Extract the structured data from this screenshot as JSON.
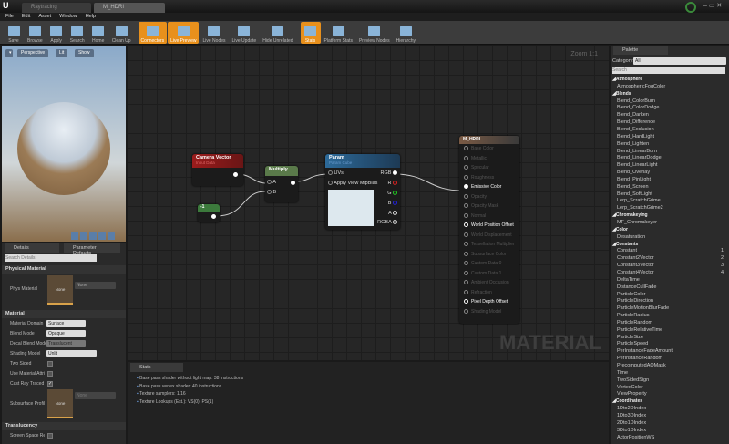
{
  "window": {
    "tabs": [
      "Raytracing",
      "M_HDRI"
    ]
  },
  "menu": [
    "File",
    "Edit",
    "Asset",
    "Window",
    "Help"
  ],
  "toolbar": [
    {
      "label": "Save",
      "active": false
    },
    {
      "label": "Browse",
      "active": false
    },
    {
      "label": "Apply",
      "active": false
    },
    {
      "label": "Search",
      "active": false
    },
    {
      "label": "Home",
      "active": false
    },
    {
      "label": "Clean Up",
      "active": false
    },
    {
      "label": "Connectors",
      "active": true
    },
    {
      "label": "Live Preview",
      "active": true
    },
    {
      "label": "Live Nodes",
      "active": false
    },
    {
      "label": "Live Update",
      "active": false
    },
    {
      "label": "Hide Unrelated",
      "active": false
    },
    {
      "label": "Stats",
      "active": true
    },
    {
      "label": "Platform Stats",
      "active": false
    },
    {
      "label": "Preview Nodes",
      "active": false
    },
    {
      "label": "Hierarchy",
      "active": false
    }
  ],
  "viewport": {
    "perspective": "Perspective",
    "lit": "Lit",
    "show": "Show"
  },
  "details": {
    "tabs": [
      "Details",
      "Parameter Defaults"
    ],
    "search_placeholder": "Search Details",
    "physical_material": {
      "title": "Physical Material",
      "phys_label": "Phys Material",
      "thumb": "None",
      "value": "None"
    },
    "material": {
      "title": "Material",
      "domain_label": "Material Domain",
      "domain": "Surface",
      "blend_label": "Blend Mode",
      "blend": "Opaque",
      "decal_label": "Decal Blend Mode",
      "decal": "Translucent",
      "shading_label": "Shading Model",
      "shading": "Unlit",
      "two_sided": "Two Sided",
      "use_attr": "Use Material Attributes",
      "cast_ray": "Cast Ray Traced Shadows",
      "subsurface_label": "Subsurface Profile",
      "subsurface_thumb": "None",
      "subsurface_value": "None"
    },
    "translucency": {
      "title": "Translucency",
      "ssr": "Screen Space Reflections"
    }
  },
  "graph": {
    "zoom": "Zoom 1:1",
    "watermark": "MATERIAL",
    "camera_vector": {
      "title": "Camera Vector",
      "subtitle": "Input Data"
    },
    "multiply": {
      "title": "Multiply",
      "a": "A",
      "b": "B"
    },
    "constant": {
      "value": "-1"
    },
    "param": {
      "title": "Param",
      "subtitle": "Param Cube",
      "uvs": "UVs",
      "mip": "Apply View MipBias",
      "outputs": [
        "RGB",
        "R",
        "G",
        "B",
        "A",
        "RGBA"
      ]
    },
    "result": {
      "title": "M_HDRI",
      "inputs": [
        {
          "label": "Base Color",
          "active": false
        },
        {
          "label": "Metallic",
          "active": false
        },
        {
          "label": "Specular",
          "active": false
        },
        {
          "label": "Roughness",
          "active": false
        },
        {
          "label": "Emissive Color",
          "active": true
        },
        {
          "label": "Opacity",
          "active": false
        },
        {
          "label": "Opacity Mask",
          "active": false
        },
        {
          "label": "Normal",
          "active": false
        },
        {
          "label": "World Position Offset",
          "active": true
        },
        {
          "label": "World Displacement",
          "active": false
        },
        {
          "label": "Tessellation Multiplier",
          "active": false
        },
        {
          "label": "Subsurface Color",
          "active": false
        },
        {
          "label": "Custom Data 0",
          "active": false
        },
        {
          "label": "Custom Data 1",
          "active": false
        },
        {
          "label": "Ambient Occlusion",
          "active": false
        },
        {
          "label": "Refraction",
          "active": false
        },
        {
          "label": "Pixel Depth Offset",
          "active": true
        },
        {
          "label": "Shading Model",
          "active": false
        }
      ]
    }
  },
  "stats": {
    "tab": "Stats",
    "lines": [
      "Base pass shader without light map: 38 instructions",
      "Base pass vertex shader: 40 instructions",
      "Texture samplers: 1/16",
      "Texture Lookups (Est.): VS(0), PS(1)"
    ]
  },
  "palette": {
    "tab": "Palette",
    "category_label": "Category:",
    "category": "All",
    "search_placeholder": "Search",
    "items": [
      {
        "t": "c",
        "l": "Atmosphere"
      },
      {
        "l": "AtmosphericFogColor"
      },
      {
        "t": "c",
        "l": "Blends"
      },
      {
        "l": "Blend_ColorBurn"
      },
      {
        "l": "Blend_ColorDodge"
      },
      {
        "l": "Blend_Darken"
      },
      {
        "l": "Blend_Difference"
      },
      {
        "l": "Blend_Exclusion"
      },
      {
        "l": "Blend_HardLight"
      },
      {
        "l": "Blend_Lighten"
      },
      {
        "l": "Blend_LinearBurn"
      },
      {
        "l": "Blend_LinearDodge"
      },
      {
        "l": "Blend_LinearLight"
      },
      {
        "l": "Blend_Overlay"
      },
      {
        "l": "Blend_PinLight"
      },
      {
        "l": "Blend_Screen"
      },
      {
        "l": "Blend_SoftLight"
      },
      {
        "l": "Lerp_ScratchGrime"
      },
      {
        "l": "Lerp_ScratchGrime2"
      },
      {
        "t": "c",
        "l": "Chromakeying"
      },
      {
        "l": "MF_Chromakeyer"
      },
      {
        "t": "c",
        "l": "Color"
      },
      {
        "l": "Desaturation"
      },
      {
        "t": "c",
        "l": "Constants"
      },
      {
        "l": "Constant",
        "n": "1"
      },
      {
        "l": "Constant2Vector",
        "n": "2"
      },
      {
        "l": "Constant3Vector",
        "n": "3"
      },
      {
        "l": "Constant4Vector",
        "n": "4"
      },
      {
        "l": "DeltaTime"
      },
      {
        "l": "DistanceCullFade"
      },
      {
        "l": "ParticleColor"
      },
      {
        "l": "ParticleDirection"
      },
      {
        "l": "ParticleMotionBlurFade"
      },
      {
        "l": "ParticleRadius"
      },
      {
        "l": "ParticleRandom"
      },
      {
        "l": "ParticleRelativeTime"
      },
      {
        "l": "ParticleSize"
      },
      {
        "l": "ParticleSpeed"
      },
      {
        "l": "PerInstanceFadeAmount"
      },
      {
        "l": "PerInstanceRandom"
      },
      {
        "l": "PrecomputedAOMask"
      },
      {
        "l": "Time"
      },
      {
        "l": "TwoSidedSign"
      },
      {
        "l": "VertexColor"
      },
      {
        "l": "ViewProperty"
      },
      {
        "t": "c",
        "l": "Coordinates"
      },
      {
        "l": "1Dto2DIndex"
      },
      {
        "l": "1Dto3DIndex"
      },
      {
        "l": "2Dto1DIndex"
      },
      {
        "l": "3Dto1DIndex"
      },
      {
        "l": "ActorPositionWS"
      }
    ]
  }
}
